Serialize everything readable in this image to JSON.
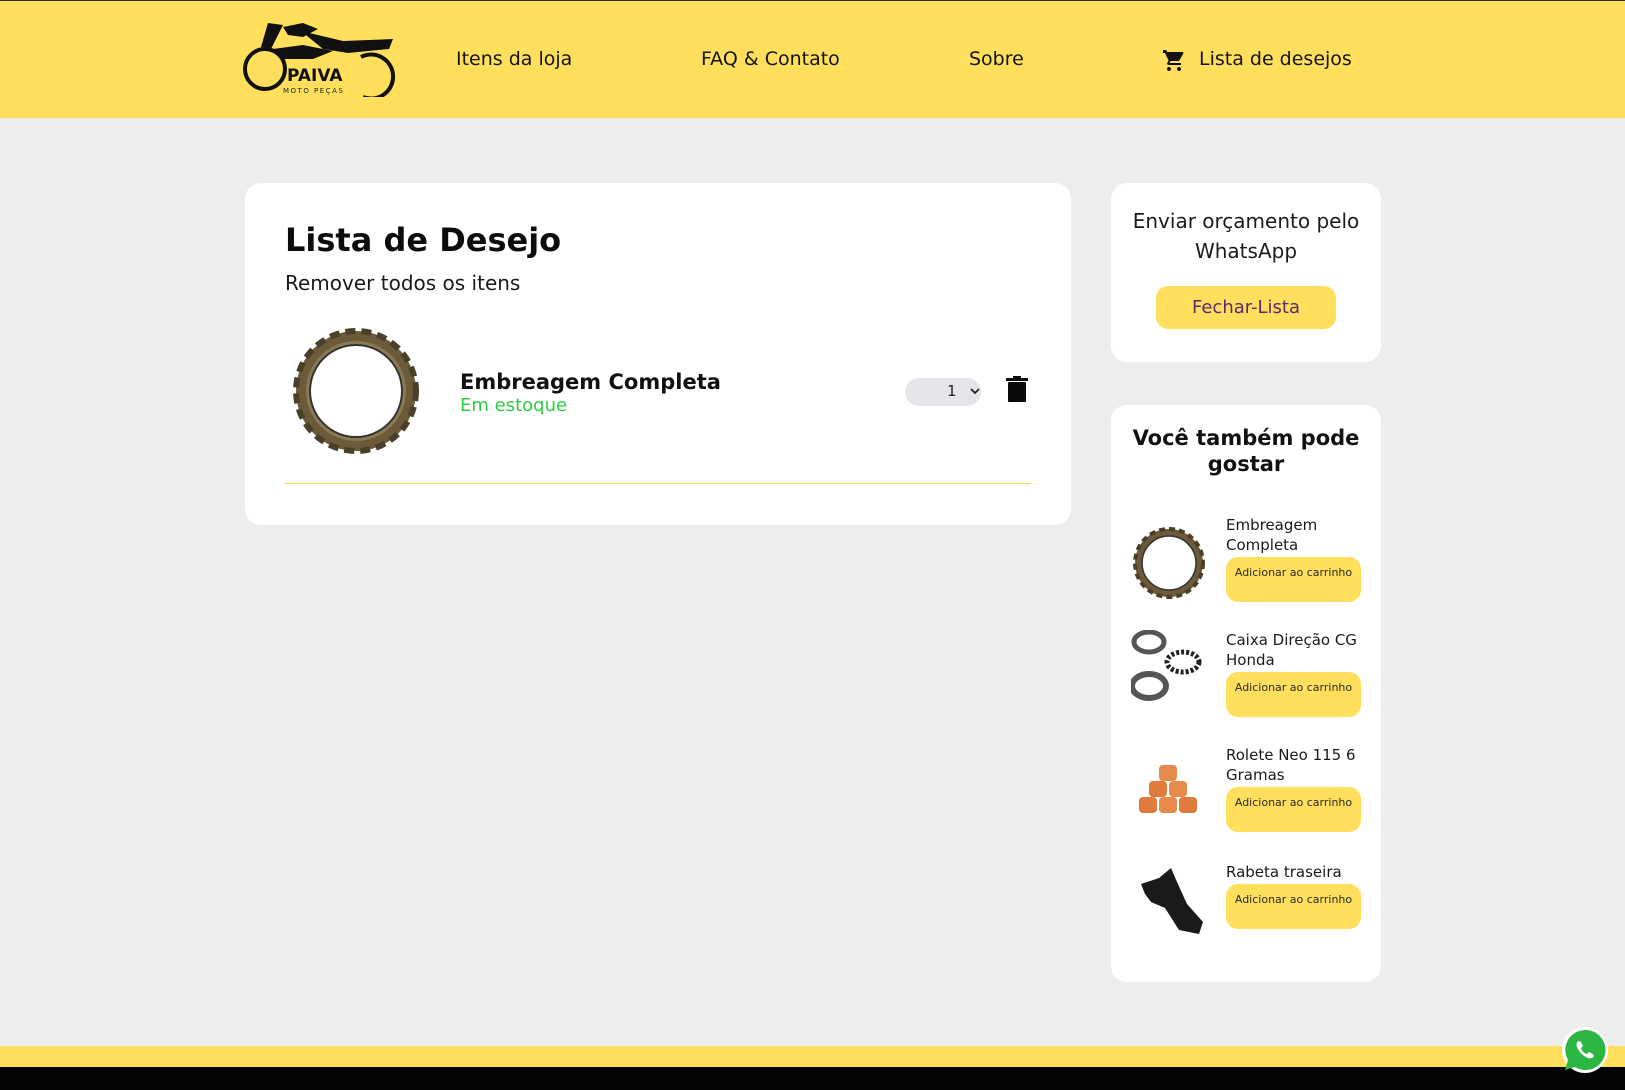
{
  "header": {
    "logo_name": "PAIVA",
    "logo_subtitle": "MOTO PEÇAS",
    "nav": {
      "store_items": "Itens da loja",
      "faq_contact": "FAQ & Contato",
      "about": "Sobre",
      "wishlist": "Lista de desejos"
    }
  },
  "wishlist": {
    "title": "Lista de Desejo",
    "remove_all": "Remover todos os itens",
    "items": [
      {
        "name": "Embreagem Completa",
        "stock": "Em estoque",
        "quantity": "1"
      }
    ]
  },
  "quote": {
    "text": "Enviar orçamento pelo WhatsApp",
    "button": "Fechar-Lista"
  },
  "suggestions": {
    "title": "Você também pode gostar",
    "items": [
      {
        "name": "Embreagem Completa",
        "button": "Adicionar ao carrinho"
      },
      {
        "name": "Caixa Direção CG Honda",
        "button": "Adicionar ao carrinho"
      },
      {
        "name": "Rolete Neo 115 6 Gramas",
        "button": "Adicionar ao carrinho"
      },
      {
        "name": "Rabeta traseira",
        "button": "Adicionar ao carrinho"
      }
    ]
  },
  "colors": {
    "brand_yellow": "#ffdf5c",
    "stock_green": "#2ecc40",
    "background": "#ededed"
  },
  "icons": [
    "cart-icon",
    "trash-icon",
    "chevron-down-icon",
    "whatsapp-icon"
  ]
}
